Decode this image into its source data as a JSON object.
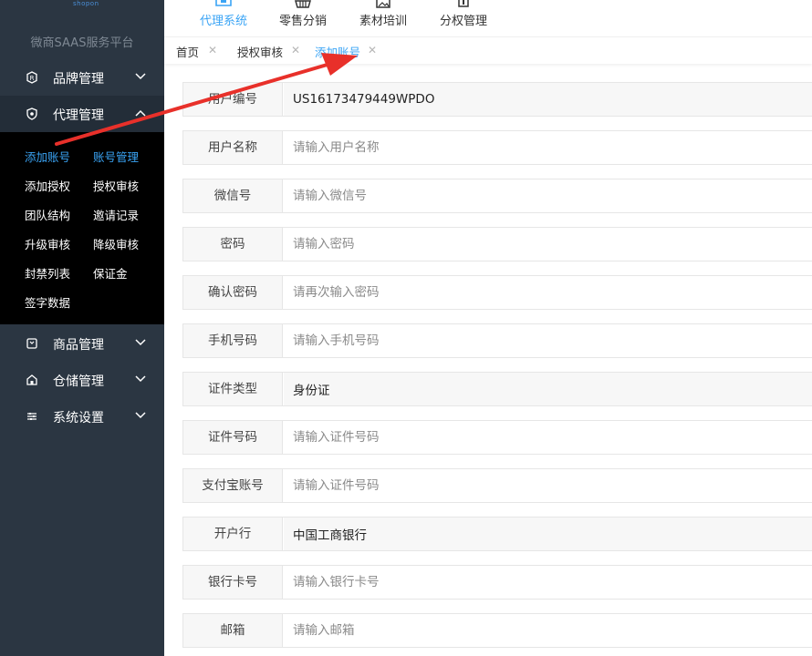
{
  "sidebar": {
    "logo_text": "shopon",
    "platform": "微商SAAS服务平台",
    "menu": [
      {
        "label": "品牌管理",
        "icon": "brand-icon"
      },
      {
        "label": "代理管理",
        "icon": "agent-icon"
      },
      {
        "label": "商品管理",
        "icon": "goods-icon"
      },
      {
        "label": "仓储管理",
        "icon": "warehouse-icon"
      },
      {
        "label": "系统设置",
        "icon": "settings-icon"
      }
    ],
    "submenu": [
      "添加账号",
      "账号管理",
      "添加授权",
      "授权审核",
      "团队结构",
      "邀请记录",
      "升级审核",
      "降级审核",
      "封禁列表",
      "保证金",
      "签字数据"
    ]
  },
  "topnav": [
    {
      "label": "代理系统",
      "icon": "agent-system-icon"
    },
    {
      "label": "零售分销",
      "icon": "basket-icon"
    },
    {
      "label": "素材培训",
      "icon": "image-icon"
    },
    {
      "label": "分权管理",
      "icon": "user-icon"
    }
  ],
  "tabs": [
    "首页",
    "授权审核",
    "添加账号"
  ],
  "form": {
    "rows": [
      {
        "label": "用户编号",
        "value": "US16173479449WPDO",
        "placeholder": ""
      },
      {
        "label": "用户名称",
        "value": "",
        "placeholder": "请输入用户名称"
      },
      {
        "label": "微信号",
        "value": "",
        "placeholder": "请输入微信号"
      },
      {
        "label": "密码",
        "value": "",
        "placeholder": "请输入密码"
      },
      {
        "label": "确认密码",
        "value": "",
        "placeholder": "请再次输入密码"
      },
      {
        "label": "手机号码",
        "value": "",
        "placeholder": "请输入手机号码"
      },
      {
        "label": "证件类型",
        "value": "身份证",
        "placeholder": ""
      },
      {
        "label": "证件号码",
        "value": "",
        "placeholder": "请输入证件号码"
      },
      {
        "label": "支付宝账号",
        "value": "",
        "placeholder": "请输入证件号码"
      },
      {
        "label": "开户行",
        "value": "中国工商银行",
        "placeholder": ""
      },
      {
        "label": "银行卡号",
        "value": "",
        "placeholder": "请输入银行卡号"
      },
      {
        "label": "邮箱",
        "value": "",
        "placeholder": "请输入邮箱"
      }
    ]
  },
  "colors": {
    "sidebar_bg": "#2b3642",
    "submenu_bg": "#000000",
    "accent": "#3aa4f5",
    "annotation_arrow": "#e8302a"
  }
}
